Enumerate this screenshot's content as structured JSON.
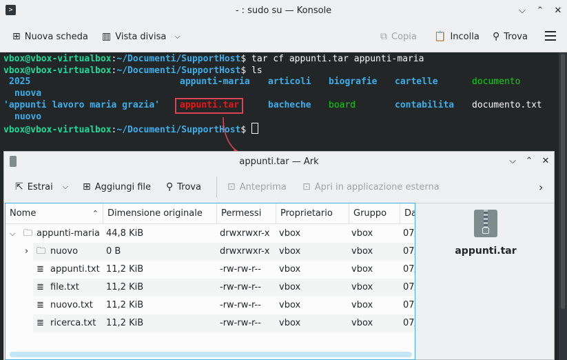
{
  "konsole": {
    "title": "- : sudo su — Konsole",
    "toolbar": {
      "new_tab": "Nuova scheda",
      "split_view": "Vista divisa",
      "copy": "Copia",
      "paste": "Incolla",
      "find": "Trova"
    },
    "terminal": {
      "prompt_user": "vbox@vbox-virtualbox",
      "prompt_sep": ":",
      "prompt_path": "~/Documenti/SupportHost",
      "prompt_symbol": "$",
      "cmd1": " tar cf appunti.tar appunti-maria",
      "cmd2": " ls",
      "ls_row1": [
        "2025",
        "appunti-maria",
        "articoli",
        "biografie",
        "cartelle",
        "documento"
      ],
      "ls_row1_wrap": "nuova",
      "ls_row2": [
        "'appunti lavoro maria grazia'",
        "appunti.tar",
        "bacheche",
        "board",
        "contabilita",
        "documento.txt"
      ],
      "ls_row2_wrap": "nuovo"
    }
  },
  "ark": {
    "title": "appunti.tar — Ark",
    "toolbar": {
      "extract": "Estrai",
      "add_file": "Aggiungi file",
      "find": "Trova",
      "preview": "Anteprima",
      "open_external": "Apri in applicazione esterna"
    },
    "columns": [
      "Nome",
      "Dimensione originale",
      "Permessi",
      "Proprietario",
      "Gruppo",
      "Da"
    ],
    "rows": [
      {
        "name": "appunti-maria",
        "size": "44,8 KiB",
        "perm": "drwxrwxr-x",
        "owner": "vbox",
        "group": "vbox",
        "date": "07/"
      },
      {
        "name": "nuovo",
        "size": "0 B",
        "perm": "drwxrwxr-x",
        "owner": "vbox",
        "group": "vbox",
        "date": "07/"
      },
      {
        "name": "appunti.txt",
        "size": "11,2 KiB",
        "perm": "-rw-rw-r--",
        "owner": "vbox",
        "group": "vbox",
        "date": "07/"
      },
      {
        "name": "file.txt",
        "size": "11,2 KiB",
        "perm": "-rw-rw-r--",
        "owner": "vbox",
        "group": "vbox",
        "date": "07/"
      },
      {
        "name": "nuovo.txt",
        "size": "11,2 KiB",
        "perm": "-rw-rw-r--",
        "owner": "vbox",
        "group": "vbox",
        "date": "07/"
      },
      {
        "name": "ricerca.txt",
        "size": "11,2 KiB",
        "perm": "-rw-rw-r--",
        "owner": "vbox",
        "group": "vbox",
        "date": "07/"
      }
    ],
    "preview_name": "appunti.tar"
  },
  "colors": {
    "terminal_bg": "#232627",
    "prompt_green": "#1cdc9a",
    "path_blue": "#3daee9",
    "highlight_red": "#da4453"
  }
}
